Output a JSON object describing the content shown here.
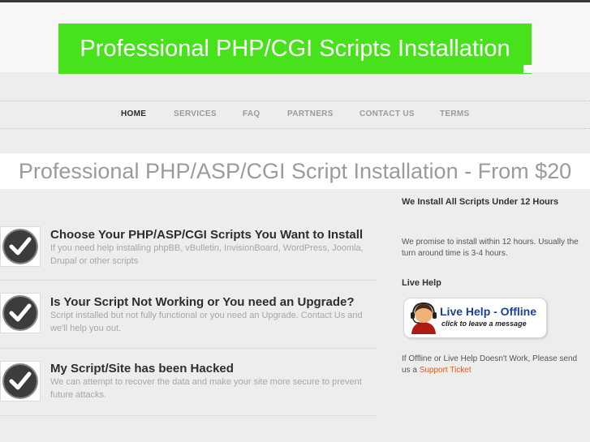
{
  "header": {
    "banner_title": "Professional PHP/CGI Scripts Installation"
  },
  "nav": {
    "items": [
      "HOME",
      "SERVICES",
      "FAQ",
      "PARTNERS",
      "CONTACT US",
      "TERMS"
    ],
    "active": "HOME"
  },
  "tagline": "Professional PHP/ASP/CGI Script Installation - From $20",
  "features": [
    {
      "title": "Choose Your PHP/ASP/CGI Scripts You Want to Install",
      "description": "If you need help installing phpBB, vBulletin, InvisionBoard, WordPress, Joomla, Drupal or other scripts"
    },
    {
      "title": "Is Your Script Not Working or You need an Upgrade?",
      "description": "Script installed but not fully functional or you need an Upgrade. Contact Us and we'll help you out."
    },
    {
      "title": "My Script/Site has been Hacked",
      "description": "We can attempt to recover the data and make your site more secure to prevent future attacks."
    }
  ],
  "sidebar": {
    "install_heading": "We Install All Scripts Under 12 Hours",
    "install_text": "We promise to install within 12 hours. Usually the turn around time is 3-4 hours.",
    "livehelp_heading": "Live Help",
    "livehelp_button": {
      "title": "Live Help - Offline",
      "subtitle": "click to leave a message"
    },
    "offline_text": "If Offline or Live Help Doesn't Work, Please send us a",
    "support_link": "Support Ticket"
  },
  "icons": {
    "feature": "checkmark-circle-icon",
    "livehelp": "support-agent-icon"
  },
  "colors": {
    "banner_bg": "#47e21b",
    "link": "#e05a1a",
    "livehelp_title": "#1b3f98"
  }
}
